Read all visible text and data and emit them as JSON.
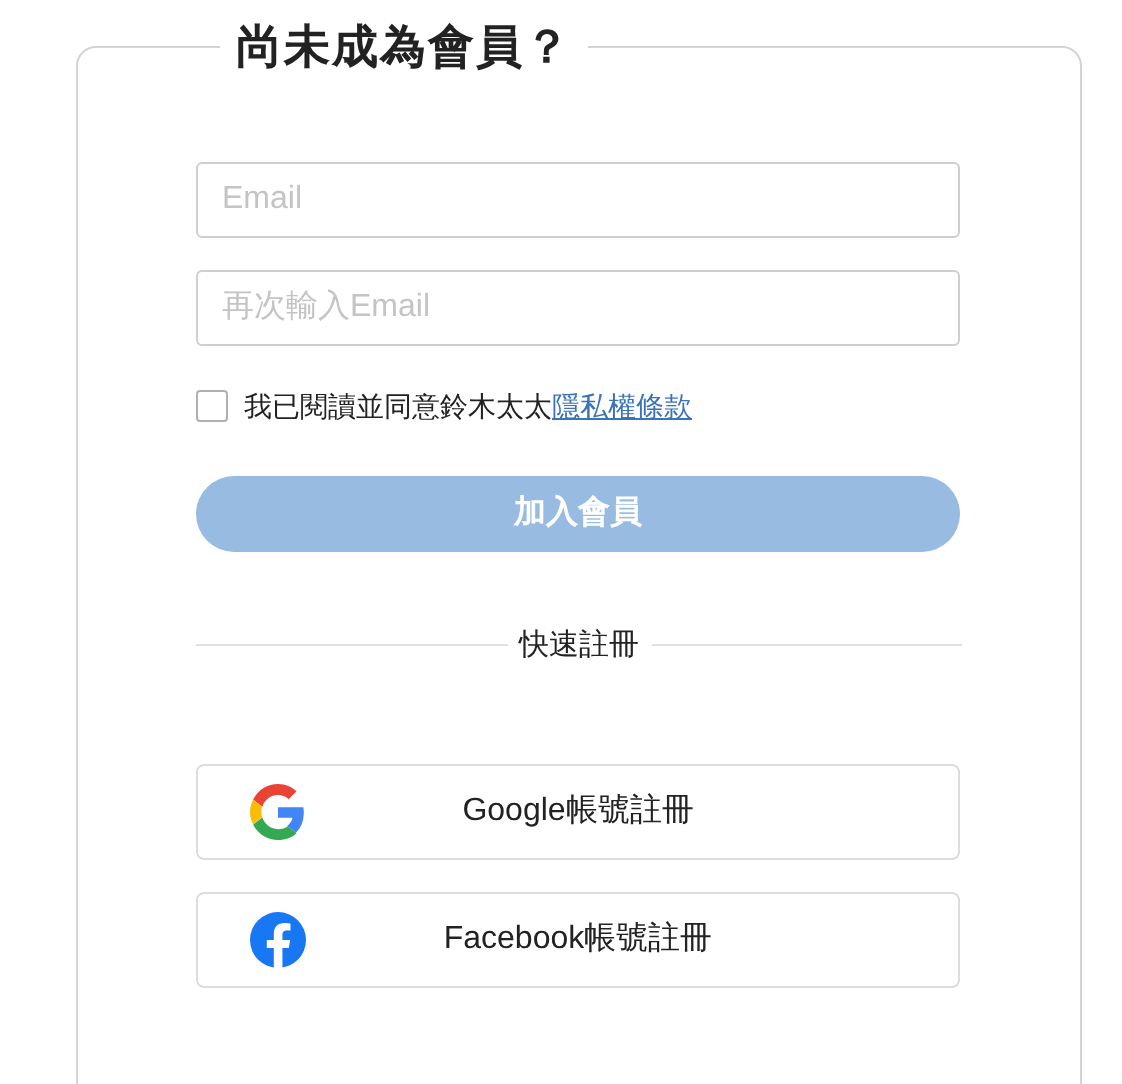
{
  "title": "尚未成為會員？",
  "fields": [
    {
      "placeholder": "Email"
    },
    {
      "placeholder": "再次輸入Email"
    }
  ],
  "agreement": {
    "checked": false,
    "text": "我已閱讀並同意鈴木太太",
    "link": "隱私權條款"
  },
  "submit": {
    "label": "加入會員",
    "disabled": true
  },
  "divider": "快速註冊",
  "social": [
    {
      "kind": "google",
      "label": "Google帳號註冊"
    },
    {
      "kind": "facebook",
      "label": "Facebook帳號註冊"
    }
  ]
}
